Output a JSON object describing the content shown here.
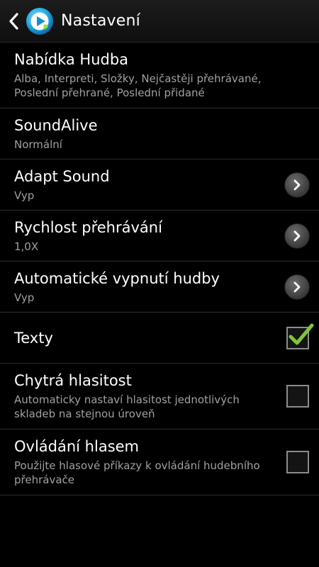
{
  "header": {
    "title": "Nastavení"
  },
  "settings": [
    {
      "title": "Nabídka Hudba",
      "summary": "Alba, Interpreti, Složky, Nejčastěji přehrávané, Poslední přehrané, Poslední přidané",
      "control": "none"
    },
    {
      "title": "SoundAlive",
      "summary": "Normální",
      "control": "none"
    },
    {
      "title": "Adapt Sound",
      "summary": "Vyp",
      "control": "chevron-right-icon"
    },
    {
      "title": "Rychlost přehrávání",
      "summary": "1,0X",
      "control": "chevron-right-icon"
    },
    {
      "title": "Automatické vypnutí hudby",
      "summary": "Vyp",
      "control": "chevron-right-icon"
    },
    {
      "title": "Texty",
      "checked": true,
      "control": "checkbox"
    },
    {
      "title": "Chytrá hlasitost",
      "summary": "Automaticky nastaví hlasitost jednotlivých skladeb na stejnou úroveň",
      "checked": false,
      "control": "checkbox"
    },
    {
      "title": "Ovládání hlasem",
      "summary": "Použijte hlasové příkazy k ovládání hudebního přehrávače",
      "checked": false,
      "control": "checkbox"
    }
  ],
  "colors": {
    "background": "#000000",
    "summary_text": "#a0a0a0",
    "divider": "#2b2b2b",
    "check_green": "#7fc63c",
    "app_icon_blue": "#1fa6e0"
  }
}
